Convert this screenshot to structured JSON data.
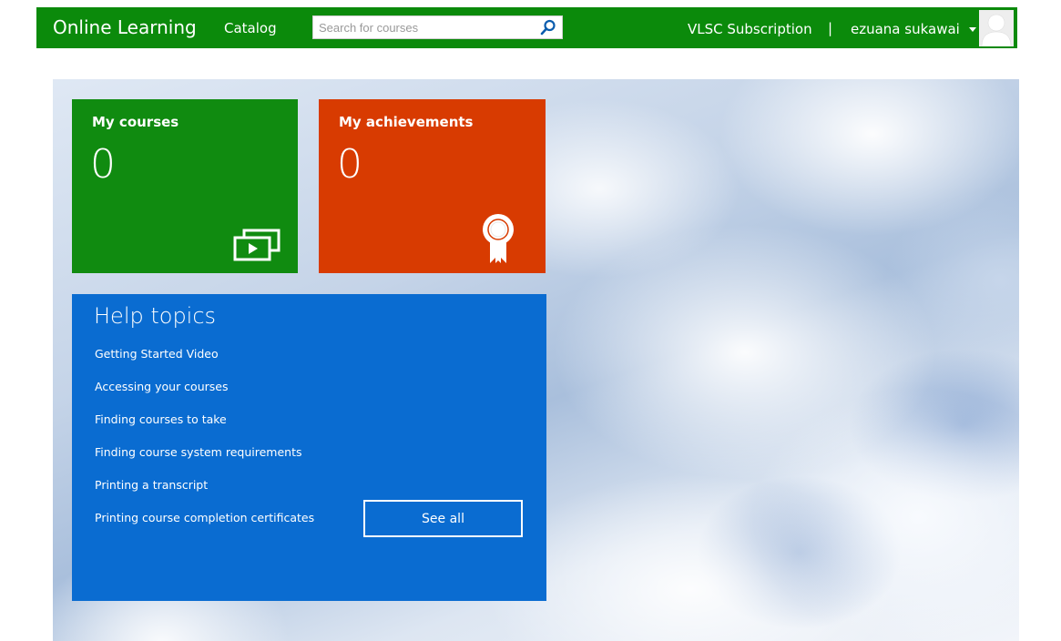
{
  "header": {
    "brand": "Online Learning",
    "nav_catalog": "Catalog",
    "search_placeholder": "Search for courses",
    "subscription": "VLSC Subscription",
    "separator": "|",
    "username": "ezuana sukawai"
  },
  "tiles": {
    "courses": {
      "title": "My courses",
      "count": "0",
      "icon": "video-stack-icon"
    },
    "achievements": {
      "title": "My achievements",
      "count": "0",
      "icon": "award-ribbon-icon"
    }
  },
  "help": {
    "title": "Help topics",
    "links": [
      "Getting Started Video",
      "Accessing your courses",
      "Finding courses to take",
      "Finding course system requirements",
      "Printing a transcript",
      "Printing course completion certificates"
    ],
    "see_all": "See all"
  },
  "colors": {
    "header_bg": "#0b8a0b",
    "courses_tile": "#108b10",
    "achievements_tile": "#d83b01",
    "help_tile": "#0a6cd1"
  }
}
